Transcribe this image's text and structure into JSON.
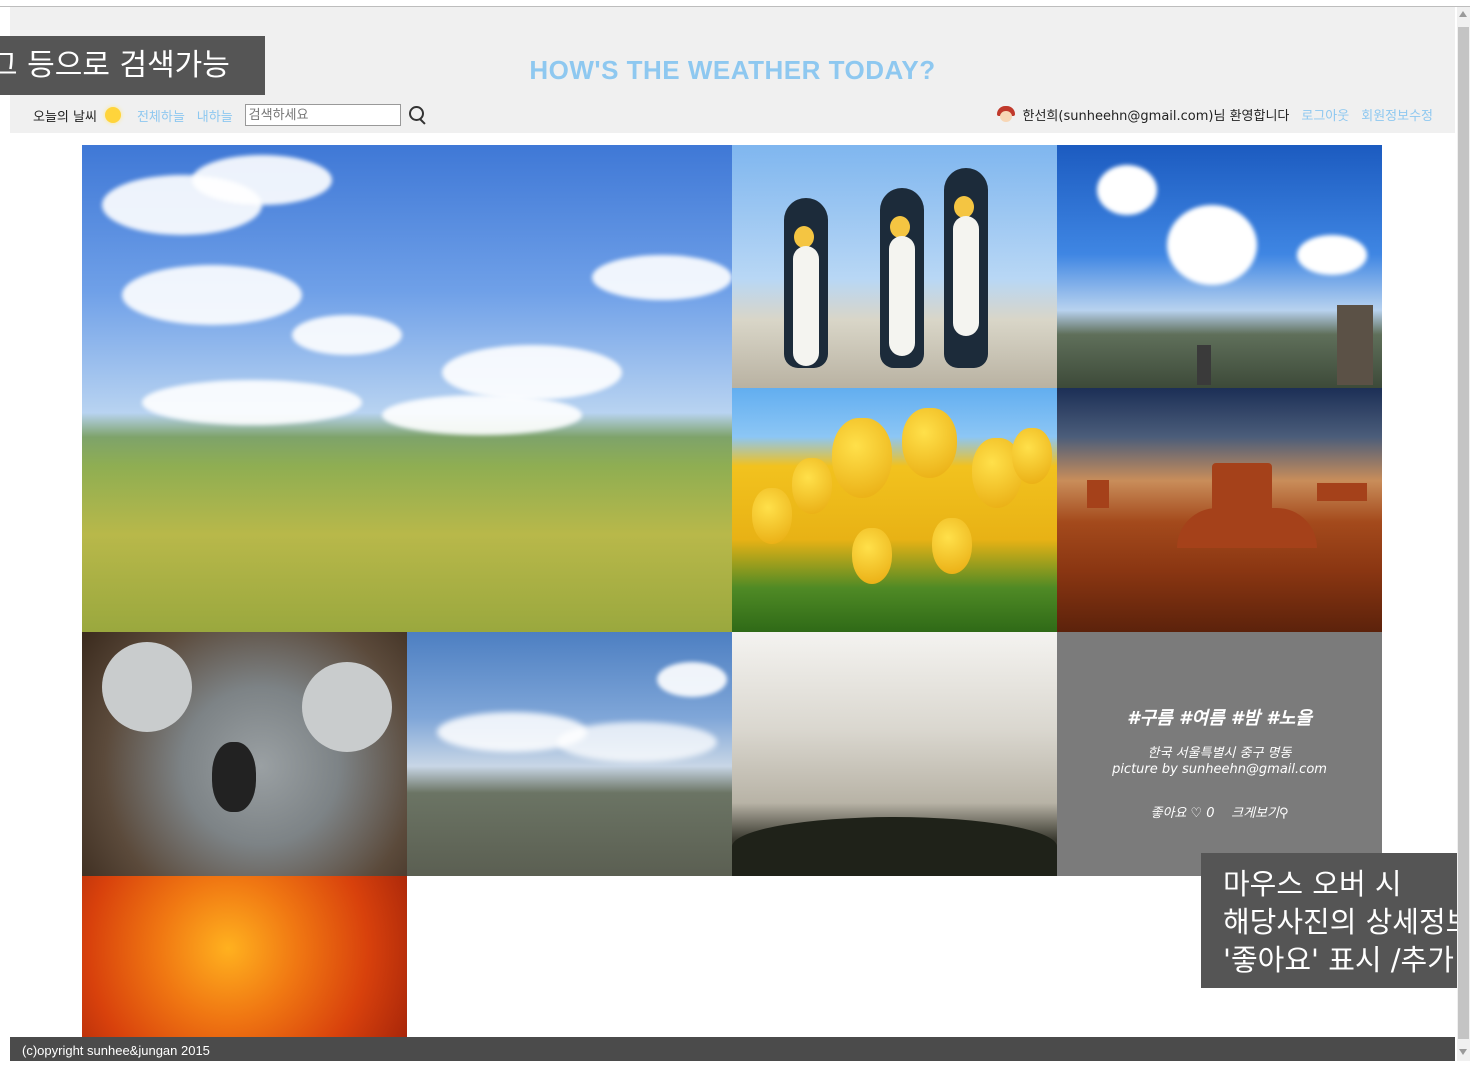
{
  "header": {
    "site_title": "HOW'S THE WEATHER TODAY?",
    "today_weather_label": "오늘의 날씨",
    "weather_icon": "sun-icon",
    "nav_all_sky": "전체하늘",
    "nav_my_sky": "내하늘",
    "search_placeholder": "검색하세요",
    "search_icon": "search-icon",
    "welcome_text": "한선희(sunheehn@gmail.com)님 환영합니다",
    "logout_link": "로그아웃",
    "edit_profile_link": "회원정보수정"
  },
  "callouts": {
    "top": "그 등으로 검색가능",
    "bottom_line1": "마우스 오버 시",
    "bottom_line2": "해당사진의 상세정보",
    "bottom_line3": "'좋아요' 표시 /추가"
  },
  "gallery": {
    "hover_card": {
      "tags": "#구름 #여름 #밤 #노을",
      "location": "한국 서울특별시 중구 명동",
      "credit": "picture by sunheehn@gmail.com",
      "like_label": "좋아요 ♡ 0",
      "zoom_label": "크게보기"
    },
    "images": [
      "field-sky",
      "penguins",
      "city-sky",
      "tulips",
      "desert-mesa",
      "koala",
      "city-panorama",
      "hazy-city",
      "orange-flower",
      "hover-card-photo"
    ]
  },
  "footer": {
    "copyright": "(c)opyright sunhee&jungan 2015"
  },
  "colors": {
    "accent": "#8ec8f0",
    "header_bg": "#f0f0f0",
    "footer_bg": "#4b4b4b",
    "callout_bg": "#555555",
    "overlay_bg": "#7b7b7b"
  }
}
